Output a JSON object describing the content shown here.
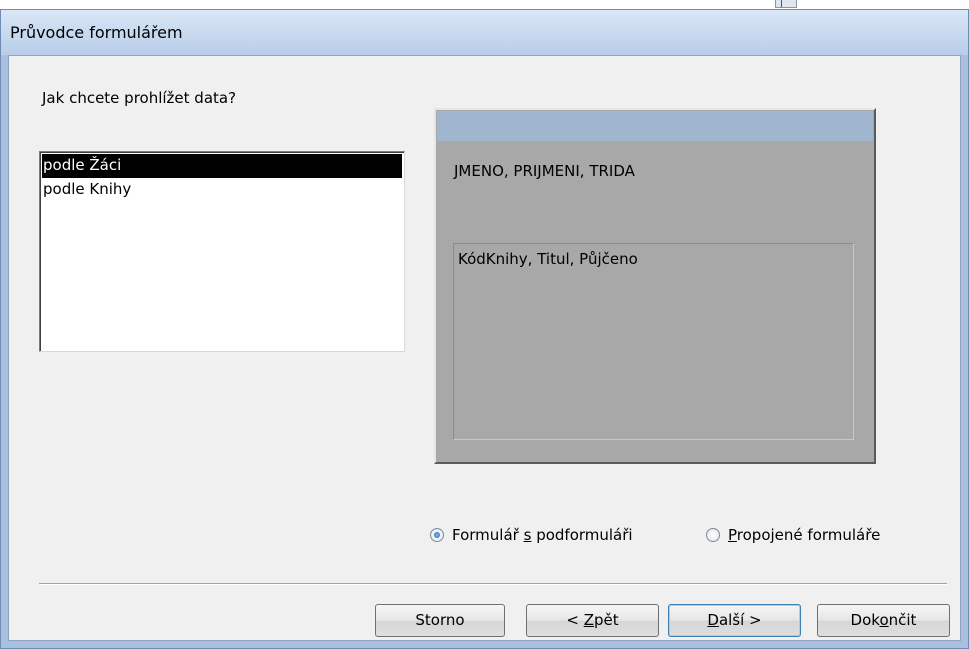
{
  "dialog": {
    "title": "Průvodce formulářem",
    "question": "Jak chcete prohlížet data?"
  },
  "view_list": {
    "items": [
      {
        "label": "podle Žáci",
        "selected": true
      },
      {
        "label": "podle Knihy",
        "selected": false
      }
    ]
  },
  "preview": {
    "main_fields": "JMENO, PRIJMENI, TRIDA",
    "sub_fields": "KódKnihy, Titul, Půjčeno"
  },
  "layout_options": {
    "subform": {
      "label_pre": "Formulář ",
      "label_key": "s",
      "label_post": " podformuláři",
      "checked": true
    },
    "linked": {
      "label_pre": "",
      "label_key": "P",
      "label_post": "ropojené formuláře",
      "checked": false
    }
  },
  "buttons": {
    "cancel": {
      "label": "Storno"
    },
    "back": {
      "label_pre": "< ",
      "label_key": "Z",
      "label_post": "pět"
    },
    "next": {
      "label_pre": "",
      "label_key": "D",
      "label_post": "alší >"
    },
    "finish": {
      "label_pre": "Dok",
      "label_key": "o",
      "label_post": "nčit"
    }
  }
}
